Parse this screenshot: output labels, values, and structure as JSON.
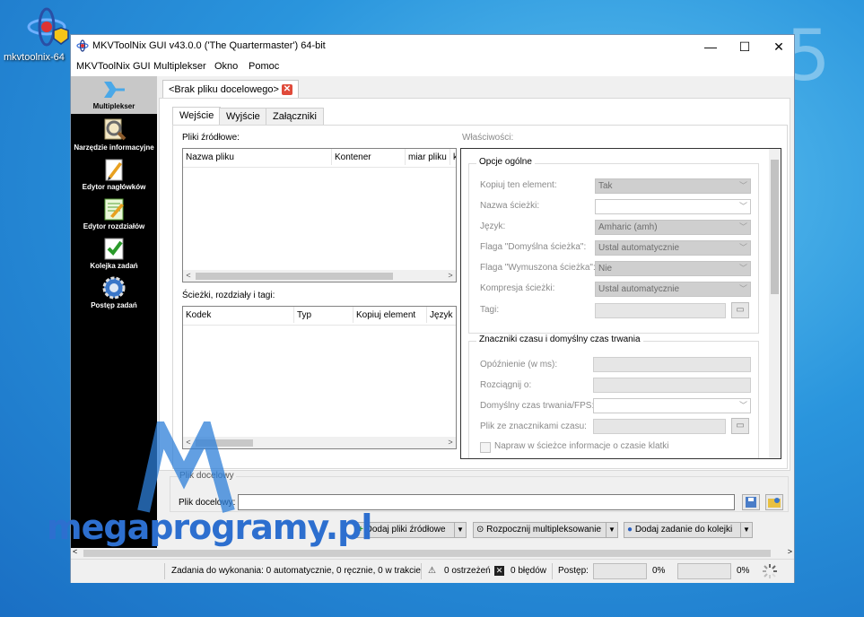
{
  "desktop": {
    "icon_label": "mkvtoolnix-64",
    "deco_number": "5"
  },
  "window": {
    "title": "MKVToolNix GUI v43.0.0 ('The Quartermaster') 64-bit",
    "minimize": "—",
    "maximize": "☐",
    "close": "✕"
  },
  "menu": {
    "items": [
      "MKVToolNix GUI",
      "Multiplekser",
      "Okno",
      "Pomoc"
    ]
  },
  "sidebar": {
    "items": [
      {
        "label": "Multiplekser",
        "icon": "multiplexer-icon"
      },
      {
        "label": "Narzędzie informacyjne",
        "icon": "info-tool-icon"
      },
      {
        "label": "Edytor nagłówków",
        "icon": "header-editor-icon"
      },
      {
        "label": "Edytor rozdziałów",
        "icon": "chapter-editor-icon"
      },
      {
        "label": "Kolejka zadań",
        "icon": "job-queue-icon"
      },
      {
        "label": "Postęp zadań",
        "icon": "job-progress-icon"
      }
    ]
  },
  "file_tab": {
    "label": "<Brak pliku docelowego>",
    "close": "✕"
  },
  "subtabs": [
    "Wejście",
    "Wyjście",
    "Załączniki"
  ],
  "sources": {
    "label": "Pliki źródłowe:",
    "columns": [
      "Nazwa pliku",
      "Kontener",
      "miar pliku",
      "k"
    ]
  },
  "tracks": {
    "label": "Ścieżki, rozdziały i tagi:",
    "columns": [
      "Kodek",
      "Typ",
      "Kopiuj element",
      "Język"
    ]
  },
  "properties": {
    "label": "Właściwości:",
    "general": {
      "title": "Opcje ogólne",
      "rows": [
        {
          "label": "Kopiuj ten element:",
          "value": "Tak"
        },
        {
          "label": "Nazwa ścieżki:",
          "value": ""
        },
        {
          "label": "Język:",
          "value": "Amharic (amh)"
        },
        {
          "label": "Flaga \"Domyślna ścieżka\":",
          "value": "Ustal automatycznie"
        },
        {
          "label": "Flaga \"Wymuszona ścieżka\":",
          "value": "Nie"
        },
        {
          "label": "Kompresja ścieżki:",
          "value": "Ustal automatycznie"
        },
        {
          "label": "Tagi:",
          "value": ""
        }
      ]
    },
    "timing": {
      "title": "Znaczniki czasu i domyślny czas trwania",
      "rows": [
        {
          "label": "Opóźnienie (w ms):"
        },
        {
          "label": "Rozciągnij o:"
        },
        {
          "label": "Domyślny czas trwania/FPS:"
        },
        {
          "label": "Plik ze znacznikami czasu:"
        }
      ],
      "checkbox": "Napraw w ścieżce informacje o czasie klatki"
    }
  },
  "output": {
    "group_label": "Plik docelowy",
    "field_label": "Plik docelowy:",
    "value": ""
  },
  "actions": {
    "add_sources": "Dodaj pliki źródłowe",
    "start_mux": "Rozpocznij multipleksowanie",
    "add_job": "Dodaj zadanie do kolejki"
  },
  "status": {
    "jobs": "Zadania do wykonania:  0 automatycznie, 0 ręcznie, 0 w trakcie",
    "warnings": "0 ostrzeżeń",
    "errors": "0 błędów",
    "progress_label": "Postęp:",
    "progress_1": "0%",
    "progress_2": "0%"
  },
  "watermark": "megaprogramy.pl",
  "colors": {
    "desktop": "#2a95dd",
    "sidebar": "#000000",
    "accent": "#2d6fcf"
  }
}
